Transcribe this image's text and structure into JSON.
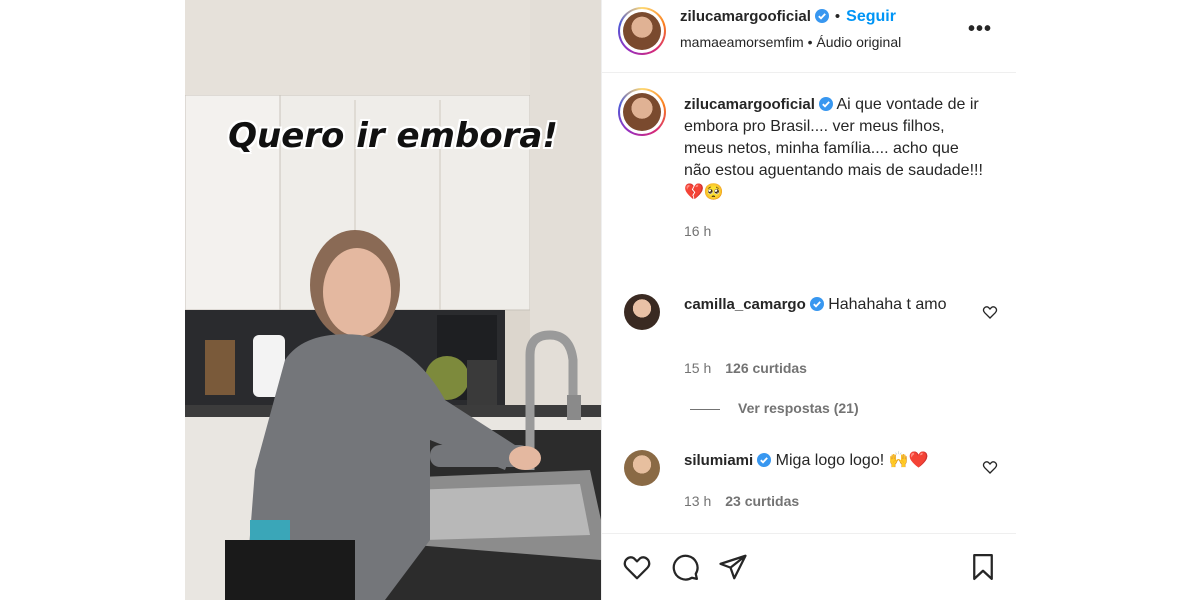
{
  "media": {
    "overlay_text": "Quero ir embora!"
  },
  "header": {
    "username": "zilucamargooficial",
    "separator": "•",
    "follow_label": "Seguir",
    "audio_user": "mamaeamorsemfim",
    "audio_separator": "•",
    "audio_label": "Áudio original",
    "more_label": "•••"
  },
  "caption": {
    "username": "zilucamargooficial",
    "text": "Ai que vontade de ir embora pro Brasil.... ver meus filhos, meus netos, minha família.... acho que não estou aguentando mais de saudade!!! 💔🥺",
    "time": "16 h"
  },
  "comments": [
    {
      "username": "camilla_camargo",
      "text": "Hahahaha t amo",
      "time": "15 h",
      "likes": "126 curtidas"
    },
    {
      "username": "silumiami",
      "text": "Miga logo logo! 🙌❤️",
      "time": "13 h",
      "likes": "23 curtidas"
    }
  ],
  "view_replies": "Ver respostas (21)",
  "colors": {
    "accent": "#0095f6",
    "verified": "#3897f0",
    "secondary_text": "#737373",
    "border": "#efefef"
  },
  "icons": {
    "like": "heart-icon",
    "comment": "comment-icon",
    "share": "paper-plane-icon",
    "save": "bookmark-icon"
  }
}
